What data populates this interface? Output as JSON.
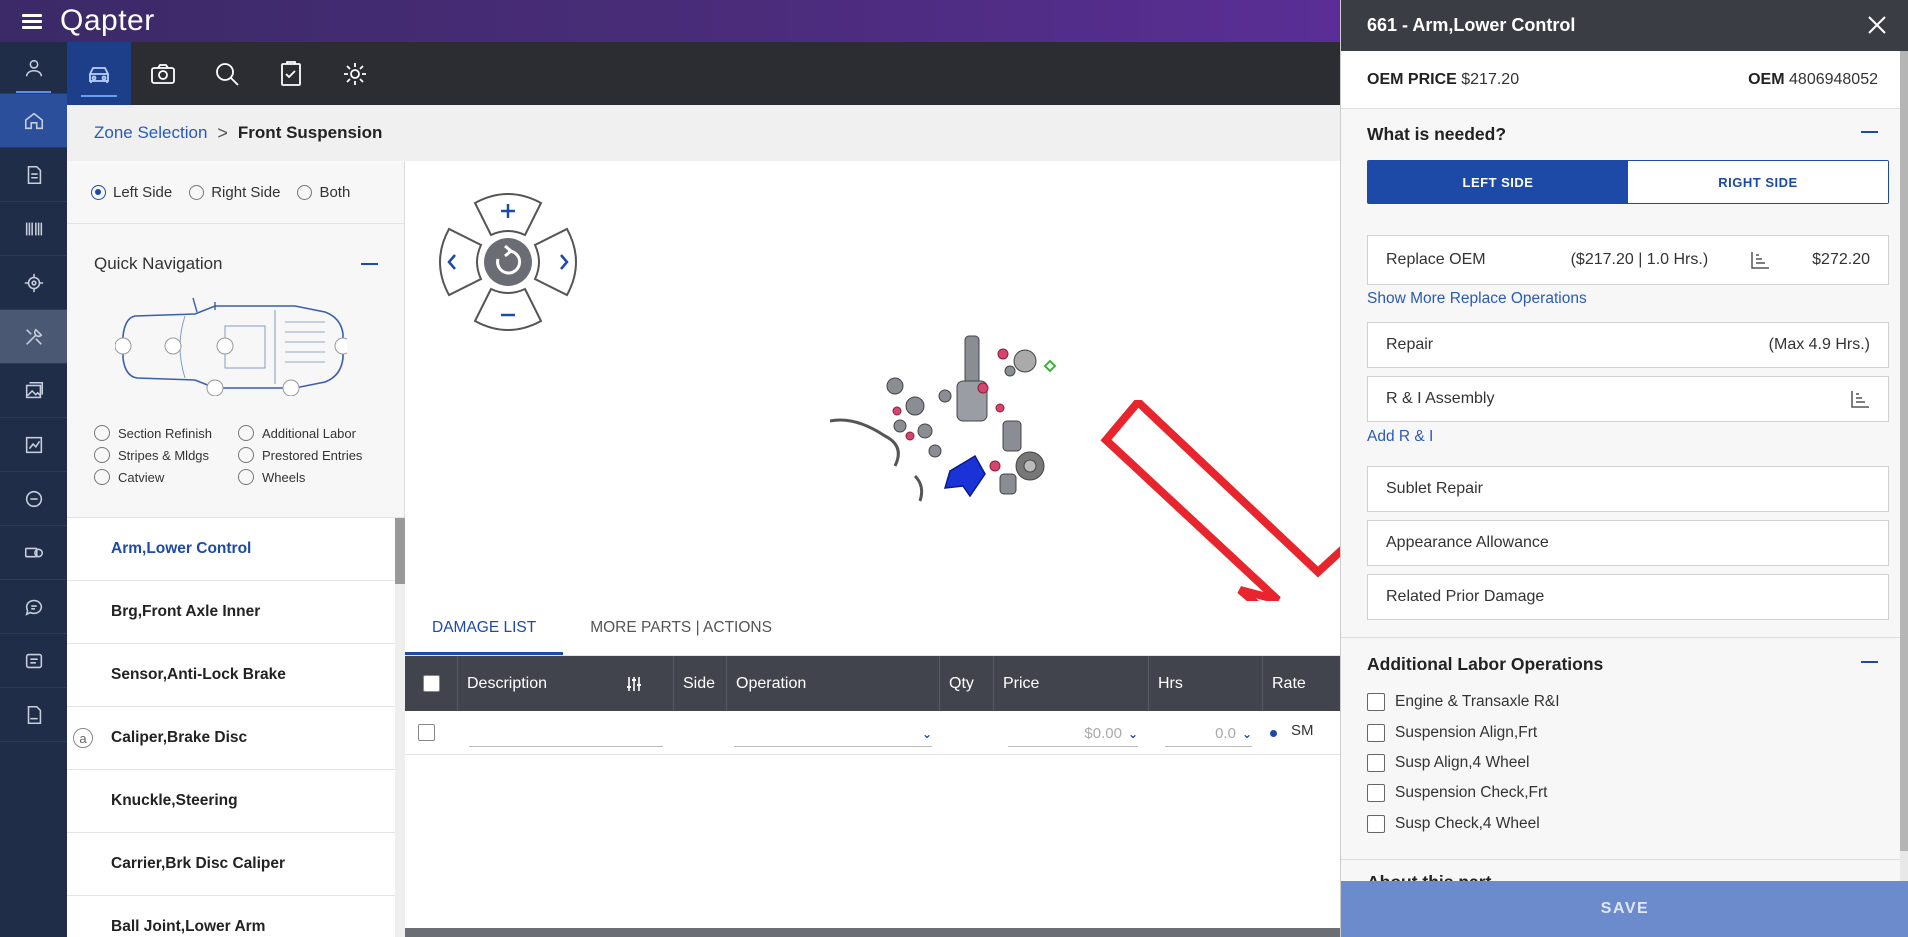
{
  "app": {
    "logo": "Qapter"
  },
  "breadcrumb": {
    "link": "Zone Selection",
    "sep": ">",
    "current": "Front Suspension"
  },
  "side_radios": [
    {
      "label": "Left Side",
      "checked": true
    },
    {
      "label": "Right Side",
      "checked": false
    },
    {
      "label": "Both",
      "checked": false
    }
  ],
  "quick_nav": {
    "title": "Quick Navigation",
    "options": [
      [
        "Section Refinish",
        "Additional Labor"
      ],
      [
        "Stripes & Mldgs",
        "Prestored Entries"
      ],
      [
        "Catview",
        "Wheels"
      ]
    ]
  },
  "parts": [
    {
      "label": "Arm,Lower Control",
      "selected": true,
      "marker": ""
    },
    {
      "label": "Brg,Front Axle Inner",
      "selected": false,
      "marker": ""
    },
    {
      "label": "Sensor,Anti-Lock Brake",
      "selected": false,
      "marker": ""
    },
    {
      "label": "Caliper,Brake Disc",
      "selected": false,
      "marker": "a"
    },
    {
      "label": "Knuckle,Steering",
      "selected": false,
      "marker": ""
    },
    {
      "label": "Carrier,Brk Disc Caliper",
      "selected": false,
      "marker": ""
    },
    {
      "label": "Ball Joint,Lower Arm",
      "selected": false,
      "marker": ""
    }
  ],
  "damage": {
    "tabs": [
      "DAMAGE LIST",
      "MORE PARTS | ACTIONS"
    ],
    "columns": [
      "Description",
      "Side",
      "Operation",
      "Qty",
      "Price",
      "Hrs",
      "Rate"
    ],
    "row": {
      "price": "$0.00",
      "hrs": "0.0",
      "rate": "SM"
    }
  },
  "panel": {
    "title": "661 - Arm,Lower Control",
    "oem_price_label": "OEM PRICE",
    "oem_price": "$217.20",
    "oem_label": "OEM",
    "oem_number": "4806948052",
    "needed_title": "What is needed?",
    "side_buttons": [
      "LEFT SIDE",
      "RIGHT SIDE"
    ],
    "replace": {
      "label": "Replace OEM",
      "detail": "($217.20 | 1.0 Hrs.)",
      "amount": "$272.20"
    },
    "show_more": "Show More Replace Operations",
    "repair": {
      "label": "Repair",
      "detail": "(Max 4.9 Hrs.)"
    },
    "ri": {
      "label": "R & I Assembly"
    },
    "add_ri": "Add R & I",
    "extra_ops": [
      "Sublet Repair",
      "Appearance Allowance",
      "Related Prior Damage"
    ],
    "labor_title": "Additional Labor Operations",
    "labor_ops": [
      "Engine & Transaxle R&I",
      "Suspension Align,Frt",
      "Susp Align,4 Wheel",
      "Suspension Check,Frt",
      "Susp Check,4 Wheel"
    ],
    "next_section": "About this part",
    "save": "SAVE"
  },
  "colors": {
    "brand": "#1c4aa6",
    "arrow": "#e8242c",
    "rail": "#1f2d48"
  }
}
